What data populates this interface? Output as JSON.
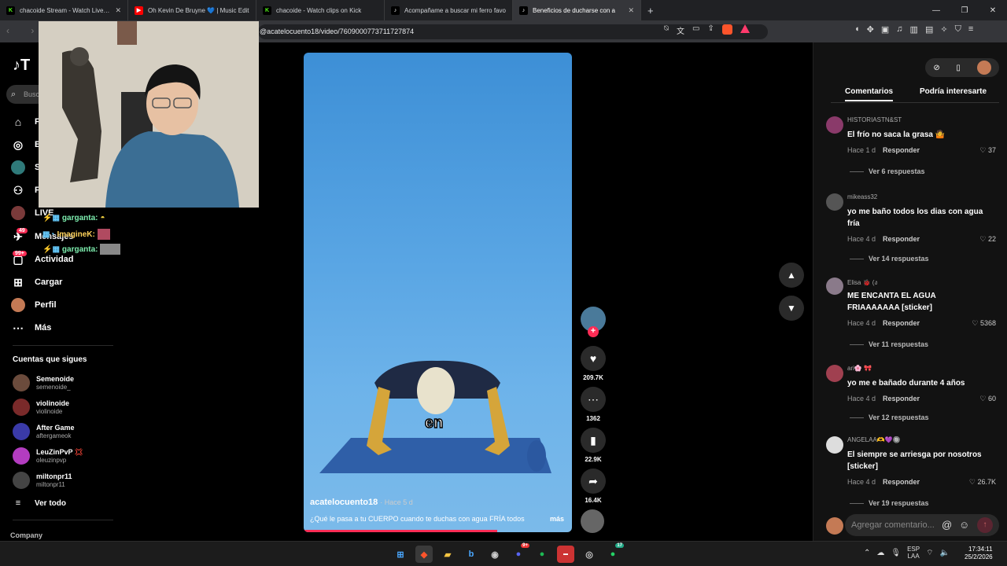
{
  "browser": {
    "tabs": [
      {
        "favicon": "kick-icon",
        "title": "chacoide Stream - Watch Live on Kick",
        "active": false
      },
      {
        "favicon": "youtube-icon",
        "title": "Oh Kevin De Bruyne 💙 | Music Edit",
        "active": false
      },
      {
        "favicon": "kick-icon",
        "title": "chacoide - Watch clips on Kick",
        "active": false
      },
      {
        "favicon": "tiktok-icon",
        "title": "Acompañame a buscar mi ferro favo",
        "active": false
      },
      {
        "favicon": "tiktok-icon",
        "title": "Beneficios de ducharse con a",
        "active": true
      }
    ],
    "url": "@acatelocuento18/video/7609000773711727874"
  },
  "sidebar": {
    "search_placeholder": "Busc",
    "menu": [
      {
        "label": "P",
        "icon": "home-icon"
      },
      {
        "label": "E",
        "icon": "explore-icon"
      },
      {
        "label": "S",
        "icon": "following-icon"
      },
      {
        "label": "F",
        "icon": "friends-icon"
      },
      {
        "label": "LIVE",
        "icon": "live-icon"
      },
      {
        "label": "Mensajes",
        "icon": "messages-icon",
        "badge": "49"
      },
      {
        "label": "Actividad",
        "icon": "activity-icon",
        "badge": "99+"
      },
      {
        "label": "Cargar",
        "icon": "upload-icon"
      },
      {
        "label": "Perfil",
        "icon": "profile-icon"
      },
      {
        "label": "Más",
        "icon": "more-icon"
      }
    ],
    "following_title": "Cuentas que sigues",
    "following": [
      {
        "name": "Semenoide",
        "handle": "semenoide_",
        "color": "#6b4b3c"
      },
      {
        "name": "violinoide",
        "handle": "violinoide",
        "color": "#7a2a2a"
      },
      {
        "name": "After Game",
        "handle": "aftergameok",
        "color": "#3a3aa8"
      },
      {
        "name": "LeuZinPvP 💢",
        "handle": "oleuzinpvp",
        "color": "#b33cc0"
      },
      {
        "name": "miltonpr11",
        "handle": "miltonpr11",
        "color": "#444"
      }
    ],
    "see_all": "Ver todo",
    "company": "Company"
  },
  "chat_overlay": [
    {
      "user": "garganta:"
    },
    {
      "user": "ImagineK:"
    },
    {
      "user": "garganta:"
    }
  ],
  "video": {
    "subtitle_word": "en",
    "author": "acatelocuento18",
    "age": "· Hace 5 d",
    "description": "¿Qué le pasa a tu CUERPO cuando te duchas con agua FRÍA todos",
    "more": "más",
    "progress_fraction": 0.72,
    "likes": "209.7K",
    "comments": "1362",
    "saves": "22.9K",
    "shares": "16.4K"
  },
  "comments_panel": {
    "tabs": [
      "Comentarios",
      "Podría interesarte"
    ],
    "comments": [
      {
        "user": "HISTORIASTN&ST",
        "text": "El frío no saca la grasa 🤷",
        "time": "Hace 1 d",
        "reply": "Responder",
        "likes": "37",
        "replies": "Ver 6 respuestas",
        "color": "#8a3a6a"
      },
      {
        "user": "mikeass32",
        "text": "yo me baño todos los dias con agua fría",
        "time": "Hace 4 d",
        "reply": "Responder",
        "likes": "22",
        "replies": "Ver 14 respuestas",
        "color": "#555"
      },
      {
        "user": "Elisa 🐞 (ง",
        "text": "ME ENCANTA EL AGUA FRIAAAAAAA [sticker]",
        "time": "Hace 4 d",
        "reply": "Responder",
        "likes": "5368",
        "replies": "Ver 11 respuestas",
        "color": "#8a7a8a"
      },
      {
        "user": "ari🌸 🎀",
        "text": "yo me e bañado durante 4 años",
        "time": "Hace 4 d",
        "reply": "Responder",
        "likes": "60",
        "replies": "Ver 12 respuestas",
        "color": "#a04050"
      },
      {
        "user": "ANGELAA🫶💜🔘",
        "text": "El siempre se arriesga por nosotros [sticker]",
        "time": "Hace 4 d",
        "reply": "Responder",
        "likes": "26.7K",
        "replies": "Ver 19 respuestas",
        "color": "#ddd"
      }
    ],
    "add_placeholder": "Agregar comentario..."
  },
  "taskbar": {
    "lang_top": "ESP",
    "lang_bottom": "LAA",
    "time": "17:34:11",
    "date": "25/2/2026",
    "discord_badge": "9+",
    "whatsapp_badge": "17"
  }
}
